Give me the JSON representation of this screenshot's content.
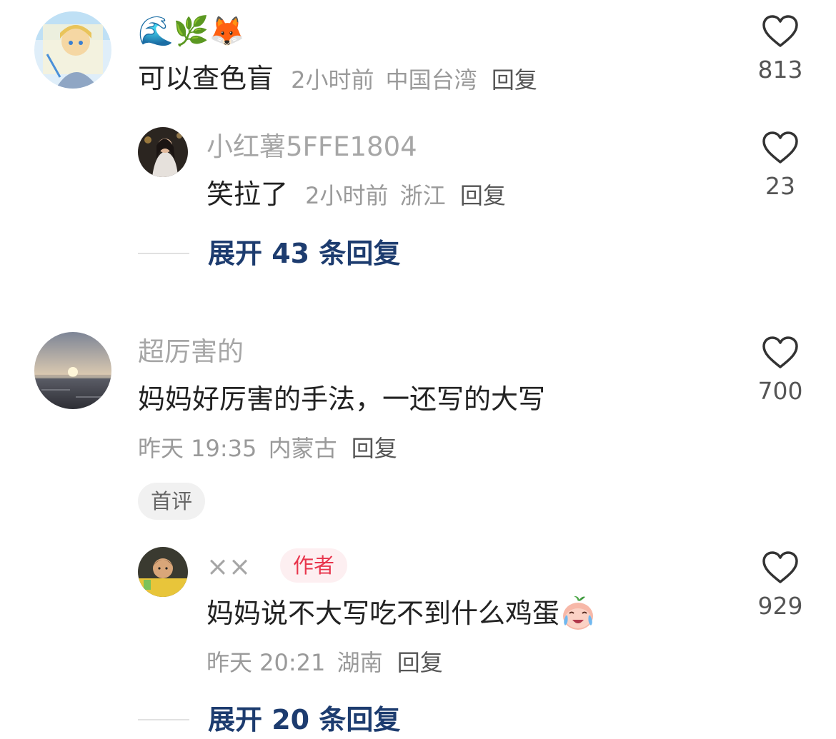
{
  "comments": [
    {
      "avatar": "anime-character-avatar",
      "name_emojis": "🌊🌿🦊",
      "text": "可以查色盲",
      "time": "2小时前",
      "location": "中国台湾",
      "reply_label": "回复",
      "likes": "813",
      "replies": [
        {
          "avatar": "girl-photo-avatar",
          "username": "小红薯5FFE1804",
          "text": "笑拉了",
          "time": "2小时前",
          "location": "浙江",
          "reply_label": "回复",
          "likes": "23"
        }
      ],
      "expand_label": "展开 43 条回复"
    },
    {
      "avatar": "sunset-sea-avatar",
      "username": "超厉害的",
      "text": "妈妈好厉害的手法，一还写的大写",
      "time": "昨天 19:35",
      "location": "内蒙古",
      "reply_label": "回复",
      "likes": "700",
      "tag": "首评",
      "replies": [
        {
          "avatar": "cartoon-boy-avatar",
          "username": "××",
          "badge": "作者",
          "text": "妈妈说不大写吃不到什么鸡蛋",
          "emoji": "crying-peach-emoji",
          "time": "昨天 20:21",
          "location": "湖南",
          "reply_label": "回复",
          "likes": "929"
        }
      ],
      "expand_label": "展开 20 条回复"
    }
  ],
  "colors": {
    "expand_link": "#1d3c6f",
    "author_badge_text": "#e8364d",
    "author_badge_bg": "#fdeff1",
    "secondary_text": "#9a9a9a"
  }
}
